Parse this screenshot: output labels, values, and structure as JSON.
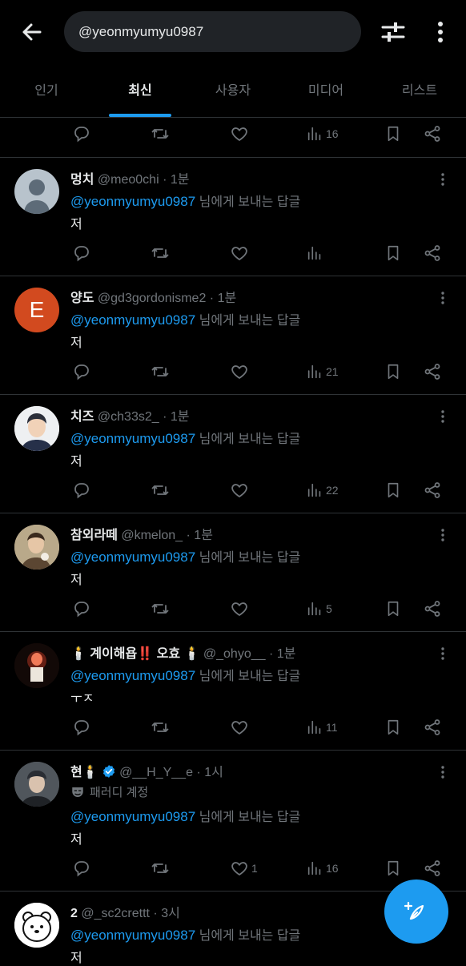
{
  "search": {
    "value": "@yeonmyumyu0987"
  },
  "tabs": [
    {
      "label": "인기"
    },
    {
      "label": "최신"
    },
    {
      "label": "사용자"
    },
    {
      "label": "미디어"
    },
    {
      "label": "리스트"
    }
  ],
  "active_tab": "최신",
  "top_actions": {
    "views": "16"
  },
  "tweets": [
    {
      "name": "멍치",
      "handle": "@meo0chi",
      "dot": "·",
      "time": "1분",
      "mention": "@yeonmyumyu0987",
      "mention_suffix": " 님에게 보내는 답글",
      "text": "저",
      "likes": "",
      "views": ""
    },
    {
      "name": "양도",
      "handle": "@gd3gordonisme2",
      "dot": "·",
      "time": "1분",
      "avatar_letter": "E",
      "mention": "@yeonmyumyu0987",
      "mention_suffix": " 님에게 보내는 답글",
      "text": "저",
      "likes": "",
      "views": "21"
    },
    {
      "name": "치즈",
      "handle": "@ch33s2_",
      "dot": "·",
      "time": "1분",
      "mention": "@yeonmyumyu0987",
      "mention_suffix": " 님에게 보내는 답글",
      "text": "저",
      "likes": "",
      "views": "22"
    },
    {
      "name": "참외라떼",
      "handle": "@kmelon_",
      "dot": "·",
      "time": "1분",
      "mention": "@yeonmyumyu0987",
      "mention_suffix": " 님에게 보내는 답글",
      "text": "저",
      "likes": "",
      "views": "5"
    },
    {
      "name": "🕯️ 계이해욥‼️ 오효 🕯️",
      "handle": "@_ohyo__",
      "dot": "·",
      "time": "1분",
      "mention": "@yeonmyumyu0987",
      "mention_suffix": " 님에게 보내는 답글",
      "text": "ㅜㅈ",
      "likes": "",
      "views": "11"
    },
    {
      "name": "현🕯️",
      "handle": "@__H_Y__e",
      "dot": "·",
      "time": "1시",
      "parody_label": "패러디 계정",
      "mention": "@yeonmyumyu0987",
      "mention_suffix": " 님에게 보내는 답글",
      "text": "저",
      "likes": "1",
      "views": "16"
    },
    {
      "name": "2",
      "handle": "@_sc2crettt",
      "dot": "·",
      "time": "3시",
      "mention": "@yeonmyumyu0987",
      "mention_suffix": " 님에게 보내는 답글",
      "text": "저",
      "likes": "",
      "views": ""
    }
  ],
  "colors": {
    "background": "#000000",
    "accent": "#1d9bf0",
    "text_primary": "#e7e9ea",
    "text_secondary": "#71767b",
    "divider": "#2f3336",
    "avatar_orange": "#d24a1f"
  },
  "icons": [
    "back-arrow-icon",
    "filter-icon",
    "more-vertical-icon",
    "reply-icon",
    "retweet-icon",
    "like-icon",
    "views-icon",
    "bookmark-icon",
    "share-icon",
    "caret-icon",
    "verified-icon",
    "parody-mask-icon",
    "compose-icon"
  ]
}
